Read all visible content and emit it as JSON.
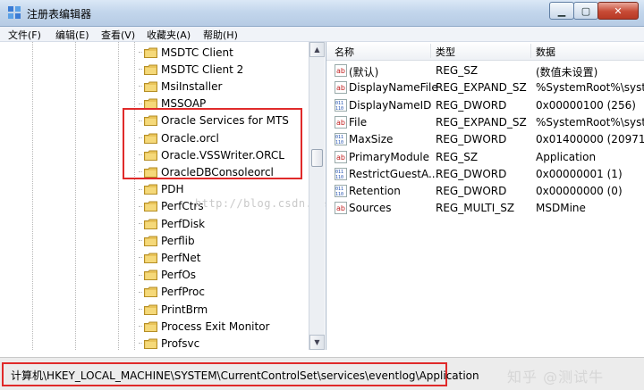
{
  "window": {
    "title": "注册表编辑器"
  },
  "menu": [
    "文件(F)",
    "编辑(E)",
    "查看(V)",
    "收藏夹(A)",
    "帮助(H)"
  ],
  "tree": {
    "items": [
      "MSDTC Client",
      "MSDTC Client 2",
      "MsiInstaller",
      "MSSOAP",
      "Oracle Services for MTS",
      "Oracle.orcl",
      "Oracle.VSSWriter.ORCL",
      "OracleDBConsoleorcl",
      "PDH",
      "PerfCtrs",
      "PerfDisk",
      "Perflib",
      "PerfNet",
      "PerfOs",
      "PerfProc",
      "PrintBrm",
      "Process Exit Monitor",
      "Profsvc"
    ],
    "highlighted": [
      "Oracle Services for MTS",
      "Oracle.orcl",
      "Oracle.VSSWriter.ORCL",
      "OracleDBConsoleorcl"
    ]
  },
  "list": {
    "columns": [
      "名称",
      "类型",
      "数据"
    ],
    "rows": [
      {
        "icon": "string-value-icon",
        "name": "(默认)",
        "type": "REG_SZ",
        "data": "(数值未设置)"
      },
      {
        "icon": "string-value-icon",
        "name": "DisplayNameFile",
        "type": "REG_EXPAND_SZ",
        "data": "%SystemRoot%\\syst"
      },
      {
        "icon": "binary-value-icon",
        "name": "DisplayNameID",
        "type": "REG_DWORD",
        "data": "0x00000100 (256)"
      },
      {
        "icon": "string-value-icon",
        "name": "File",
        "type": "REG_EXPAND_SZ",
        "data": "%SystemRoot%\\syst"
      },
      {
        "icon": "binary-value-icon",
        "name": "MaxSize",
        "type": "REG_DWORD",
        "data": "0x01400000 (209715"
      },
      {
        "icon": "string-value-icon",
        "name": "PrimaryModule",
        "type": "REG_SZ",
        "data": "Application"
      },
      {
        "icon": "binary-value-icon",
        "name": "RestrictGuestA...",
        "type": "REG_DWORD",
        "data": "0x00000001 (1)"
      },
      {
        "icon": "binary-value-icon",
        "name": "Retention",
        "type": "REG_DWORD",
        "data": "0x00000000 (0)"
      },
      {
        "icon": "string-value-icon",
        "name": "Sources",
        "type": "REG_MULTI_SZ",
        "data": "MSDMine"
      }
    ]
  },
  "status": {
    "path": "计算机\\HKEY_LOCAL_MACHINE\\SYSTEM\\CurrentControlSet\\services\\eventlog\\Application"
  },
  "watermark": "http://blog.csdn.net/Devin_LiuYu",
  "brand": "知乎 @测试牛",
  "colors": {
    "highlight": "#e02a2a",
    "folder": "#e9c45a",
    "titlebar": "#c3d6ec"
  }
}
